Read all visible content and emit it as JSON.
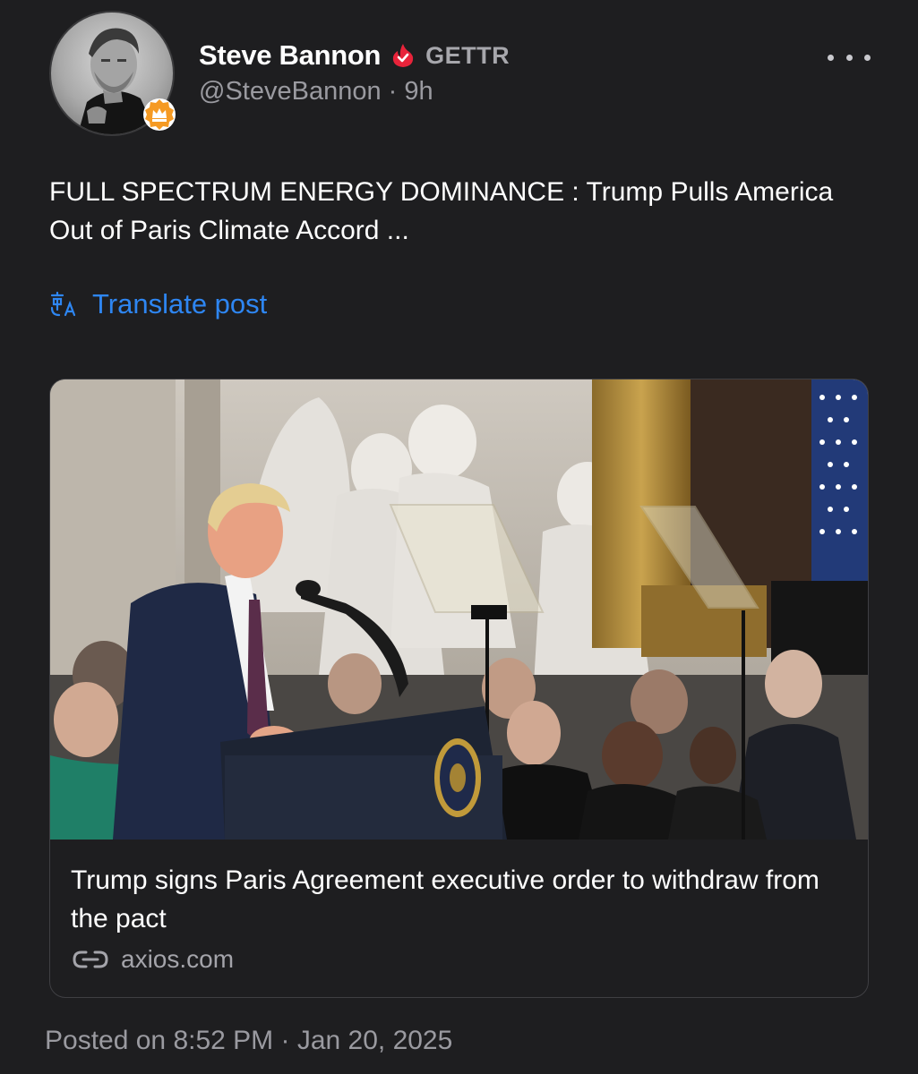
{
  "author": {
    "name": "Steve Bannon",
    "platform": "GETTR",
    "handle": "@SteveBannon",
    "time": "9h"
  },
  "post": {
    "text": "FULL SPECTRUM ENERGY DOMINANCE : Trump Pulls America Out of Paris Climate Accord ...",
    "translate_label": "Translate post"
  },
  "link_card": {
    "title": "Trump signs Paris Agreement executive order to withdraw from the pact",
    "source": "axios.com"
  },
  "footer": {
    "posted_on": "Posted on 8:52 PM · Jan 20, 2025"
  },
  "icons": {
    "verified": "fire-badge-icon",
    "badge": "crown-badge-icon",
    "more": "more-dots-icon",
    "translate": "translate-icon",
    "link": "link-icon"
  },
  "colors": {
    "background": "#1e1e20",
    "accent_blue": "#2e86f2",
    "verified_red": "#e8233a",
    "badge_orange": "#f59a23",
    "muted_text": "#9a9aa0"
  }
}
